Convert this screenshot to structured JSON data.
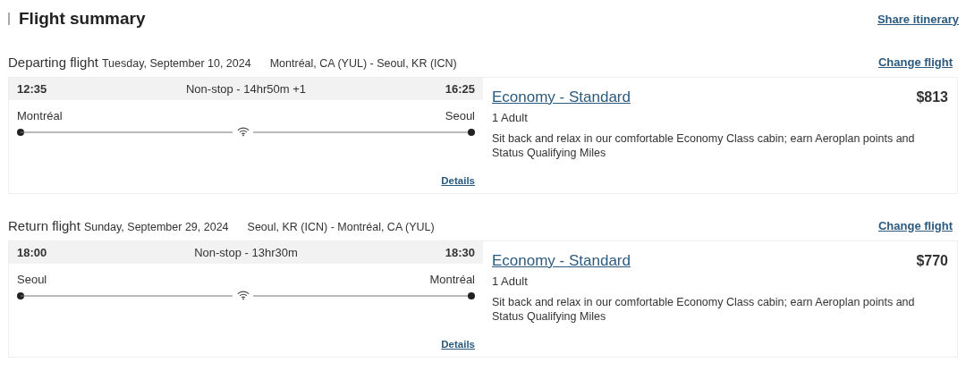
{
  "title": "Flight summary",
  "share_link": "Share itinerary",
  "flights": [
    {
      "label": "Departing flight",
      "date": "Tuesday, September 10, 2024",
      "route": "Montréal, CA (YUL) - Seoul, KR (ICN)",
      "change_link": "Change flight",
      "depart_time": "12:35",
      "duration": "Non-stop - 14hr50m +1",
      "arrive_time": "16:25",
      "origin": "Montréal",
      "destination": "Seoul",
      "details_link": "Details",
      "fare": "Economy - Standard",
      "price": "$813",
      "passengers": "1 Adult",
      "description": "Sit back and relax in our comfortable Economy Class cabin; earn Aeroplan points and Status Qualifying Miles"
    },
    {
      "label": "Return flight",
      "date": "Sunday, September 29, 2024",
      "route": "Seoul, KR (ICN) - Montréal, CA (YUL)",
      "change_link": "Change flight",
      "depart_time": "18:00",
      "duration": "Non-stop - 13hr30m",
      "arrive_time": "18:30",
      "origin": "Seoul",
      "destination": "Montréal",
      "details_link": "Details",
      "fare": "Economy - Standard",
      "price": "$770",
      "passengers": "1 Adult",
      "description": "Sit back and relax in our comfortable Economy Class cabin; earn Aeroplan points and Status Qualifying Miles"
    }
  ]
}
